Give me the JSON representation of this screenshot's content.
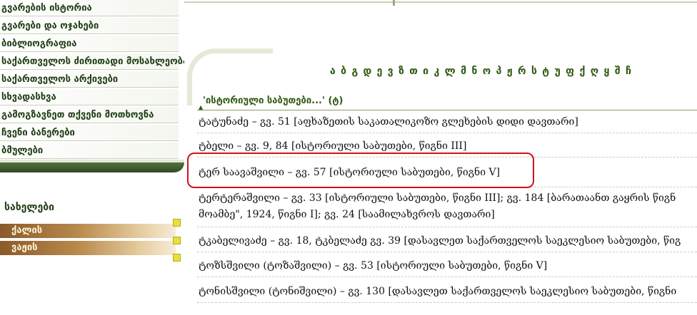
{
  "sidebar": {
    "menu": [
      "გვარების ისტორია",
      "გვარები და ოჯახები",
      "ბიბლიოგრაფია",
      "საქართველოს ძირითადი მოსახლეობა",
      "საქართველოს არქივები",
      "სხვადასხვა",
      "გამოგზავნეთ თქვენი მოთხოვნა",
      "ჩვენი ბანერები",
      "ბმულები"
    ],
    "section_title": "სახელები",
    "sub_items": [
      "ქალის",
      "ვაჟის"
    ]
  },
  "alphabet": [
    "ა",
    "ბ",
    "გ",
    "დ",
    "ე",
    "ვ",
    "ზ",
    "თ",
    "ი",
    "კ",
    "ლ",
    "მ",
    "ნ",
    "ო",
    "პ",
    "ჟ",
    "რ",
    "ს",
    "ტ",
    "უ",
    "ფ",
    "ქ",
    "ღ",
    "ყ",
    "შ",
    "ჩ"
  ],
  "heading": "'ისტორიული საბუთები...'   (ტ)",
  "entries": [
    {
      "lines": [
        "ტატუნაძე – გვ. 51 [აფხაზეთის საკათალიკოზო გლეხების დიდი დავთარი]"
      ]
    },
    {
      "lines": [
        "ტბელი – გვ. 9, 84 [ისტორიული საბუთები, წიგნი III]"
      ]
    },
    {
      "lines": [
        "ტერ საავაშვილი – გვ. 57 [ისტორიული საბუთები, წიგნი V]"
      ],
      "highlighted": true
    },
    {
      "lines": [
        "ტერტერაშვილი – გვ. 33 [ისტორიული საბუთები, წიგნი III]; გვ. 184 [ბარათაანთ გაყრის წიგნ",
        "მოამბე\", 1924, წიგნი I]; გვ. 24 [საამილახვროს დავთარი]"
      ]
    },
    {
      "lines": [
        "ტკაბელივაძე – გვ. 18, ტკბელაძე გვ. 39 [დასავლეთ საქართველოს საეკლესიო საბუთები, წიგ"
      ]
    },
    {
      "lines": [
        "ტოზსშვილი (ტოზაშვილი) – გვ. 53 [ისტორიული საბუთები, წიგნი V]"
      ]
    },
    {
      "lines": [
        "ტონისშვილი (ტონიშვილი) – გვ. 130 [დასავლეთ საქართველოს საეკლესიო საბუთები, წიგნი"
      ]
    }
  ],
  "colors": {
    "highlight": "#d0121b",
    "accent": "#2f5a12",
    "sidebar_dark": "#2f4a22"
  }
}
